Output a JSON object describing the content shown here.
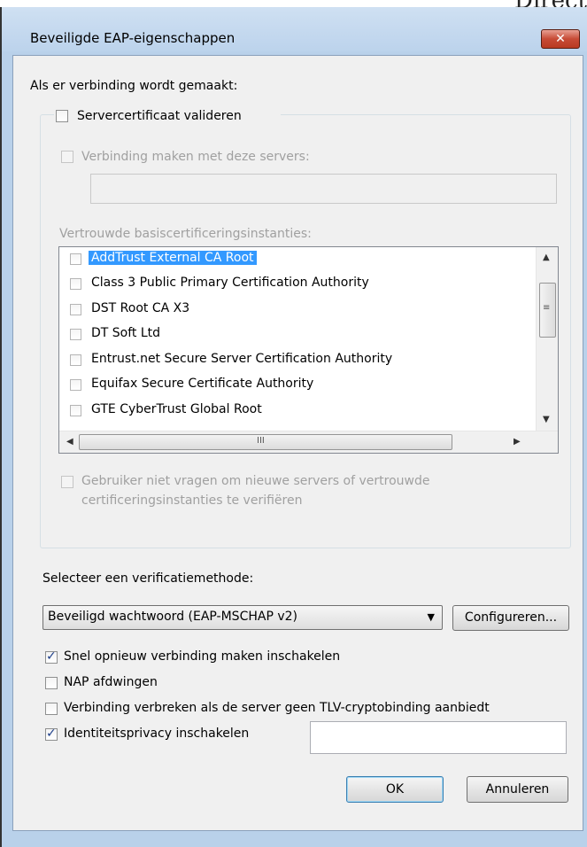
{
  "background_text": "Direct",
  "window": {
    "title": "Beveiligde EAP-eigenschappen",
    "close_glyph": "✕"
  },
  "connect_label": "Als er verbinding wordt gemaakt:",
  "validate_cert": {
    "label": "Servercertificaat valideren",
    "checked": false
  },
  "connect_servers": {
    "label": "Verbinding maken met deze servers:",
    "checked": false,
    "value": ""
  },
  "trusted_ca_label": "Vertrouwde basiscertificeringsinstanties:",
  "ca_list": [
    {
      "label": "AddTrust External CA Root",
      "selected": true
    },
    {
      "label": "Class 3 Public Primary Certification Authority"
    },
    {
      "label": "DST Root CA X3"
    },
    {
      "label": "DT Soft Ltd"
    },
    {
      "label": "Entrust.net Secure Server Certification Authority"
    },
    {
      "label": "Equifax Secure Certificate Authority"
    },
    {
      "label": "GTE CyberTrust Global Root"
    }
  ],
  "scroll_glyphs": {
    "up": "▲",
    "down": "▼",
    "left": "◀",
    "right": "▶",
    "grip_v": "≡",
    "grip_h": "III"
  },
  "no_prompt": {
    "line1": "Gebruiker niet vragen om nieuwe servers of vertrouwde",
    "line2": "certificeringsinstanties te verifiëren"
  },
  "method_label": "Selecteer een verificatiemethode:",
  "method_select": {
    "value": "Beveiligd wachtwoord (EAP-MSCHAP v2)",
    "arrow": "▼"
  },
  "configure_button": "Configureren...",
  "options": {
    "fast_reconnect": {
      "label": "Snel opnieuw verbinding maken inschakelen",
      "checked": true
    },
    "nap": {
      "label": "NAP afdwingen",
      "checked": false
    },
    "tlv": {
      "label": "Verbinding verbreken als de server geen TLV-cryptobinding aanbiedt",
      "checked": false
    },
    "identity_privacy": {
      "label": "Identiteitsprivacy inschakelen",
      "checked": true,
      "value": ""
    }
  },
  "buttons": {
    "ok": "OK",
    "cancel": "Annuleren"
  }
}
